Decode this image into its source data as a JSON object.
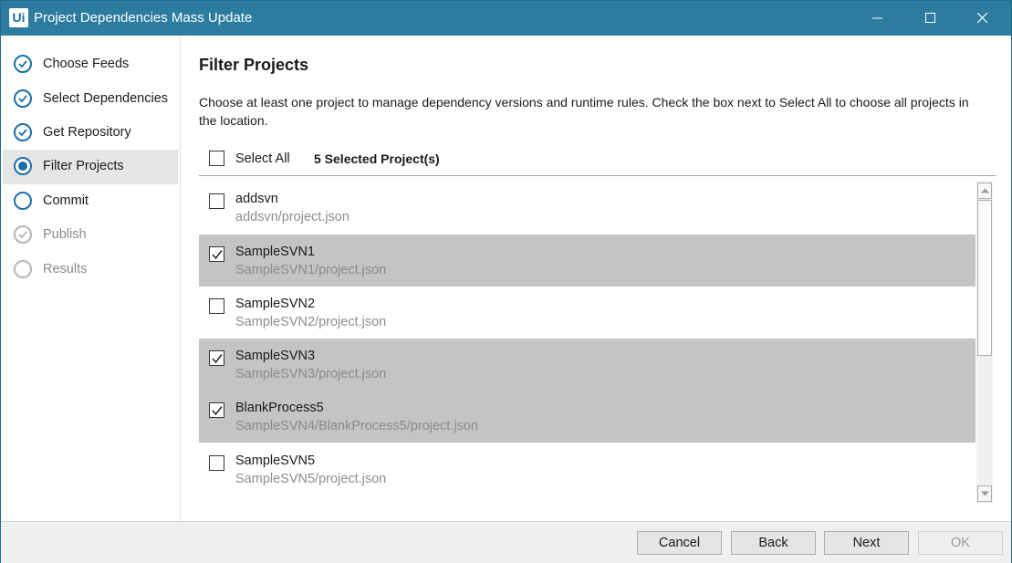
{
  "window": {
    "logo": "Ui",
    "title": "Project Dependencies Mass Update"
  },
  "sidebar": {
    "steps": [
      {
        "label": "Choose Feeds",
        "state": "done"
      },
      {
        "label": "Select Dependencies",
        "state": "done"
      },
      {
        "label": "Get Repository",
        "state": "done"
      },
      {
        "label": "Filter Projects",
        "state": "active"
      },
      {
        "label": "Commit",
        "state": "pending"
      },
      {
        "label": "Publish",
        "state": "disabled"
      },
      {
        "label": "Results",
        "state": "disabled"
      }
    ]
  },
  "main": {
    "title": "Filter Projects",
    "description": "Choose at least one project to manage dependency versions and runtime rules. Check the box next to Select All to choose all projects in the location.",
    "select_all_label": "Select All",
    "selected_count": "5 Selected Project(s)",
    "projects": [
      {
        "name": "addsvn",
        "path": "addsvn/project.json",
        "checked": false
      },
      {
        "name": "SampleSVN1",
        "path": "SampleSVN1/project.json",
        "checked": true
      },
      {
        "name": "SampleSVN2",
        "path": "SampleSVN2/project.json",
        "checked": false
      },
      {
        "name": "SampleSVN3",
        "path": "SampleSVN3/project.json",
        "checked": true
      },
      {
        "name": "BlankProcess5",
        "path": "SampleSVN4/BlankProcess5/project.json",
        "checked": true
      },
      {
        "name": "SampleSVN5",
        "path": "SampleSVN5/project.json",
        "checked": false
      }
    ]
  },
  "footer": {
    "cancel_label": "Cancel",
    "back_label": "Back",
    "next_label": "Next",
    "ok_label": "OK"
  },
  "colors": {
    "titlebar": "#2c7c9f",
    "accent": "#1a6fa8",
    "selected_row": "#c4c4c4"
  }
}
